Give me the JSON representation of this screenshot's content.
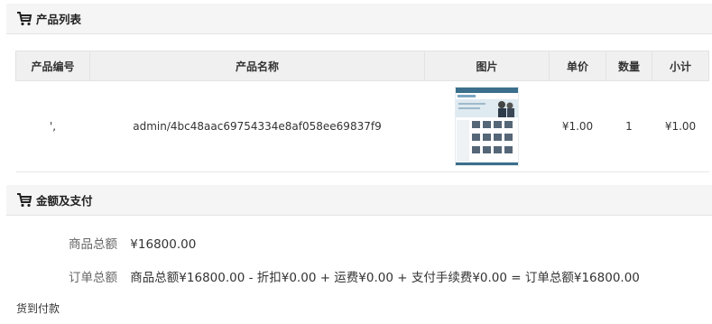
{
  "sections": {
    "product_list_title": "产品列表",
    "payment_title": "金额及支付"
  },
  "product_table": {
    "headers": [
      "产品编号",
      "产品名称",
      "图片",
      "单价",
      "数量",
      "小计"
    ],
    "rows": [
      {
        "code": "',",
        "name": "admin/4bc48aac69754334e8af058ee69837f9",
        "thumbnail_icon": "product-screenshot-thumbnail",
        "unit_price": "¥1.00",
        "quantity": "1",
        "subtotal": "¥1.00"
      }
    ]
  },
  "summary": {
    "goods_total_label": "商品总额",
    "goods_total_value": "¥16800.00",
    "order_total_label": "订单总额",
    "order_total_formula": "商品总额¥16800.00 - 折扣¥0.00 + 运费¥0.00 + 支付手续费¥0.00 = 订单总额¥16800.00"
  },
  "payment_method": "货到付款",
  "colors": {
    "header_bg": "#f5f5f5",
    "table_head_bg": "#f0f0f0",
    "quantity_red": "#d9262c"
  }
}
